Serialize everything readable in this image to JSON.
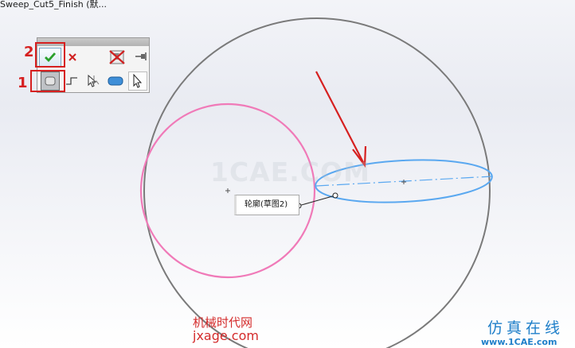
{
  "document": {
    "title": "Sweep_Cut5_Finish (默..."
  },
  "toolbar": {
    "ok_icon": "check-icon",
    "cancel_icon": "close-icon",
    "clear_selection_icon": "clear-selection-icon",
    "pin_icon": "pin-icon",
    "filters": [
      "profile-filter-icon",
      "curve-filter-icon",
      "select-other-icon",
      "face-filter-icon",
      "pointer-icon"
    ],
    "colors": {
      "ok": "#2aa02a",
      "cancel": "#d02020"
    }
  },
  "annotations": {
    "marker_1": "1",
    "marker_2": "2",
    "color": "#d62020"
  },
  "viewport": {
    "callout_label": "轮廓(草图2)",
    "colors": {
      "sphere": "#7a7a7a",
      "profile_circle": "#f07ab8",
      "path_ellipse": "#5aa8f0",
      "arrow": "#d62020"
    }
  },
  "watermarks": {
    "center": "1CAE.COM",
    "site_name": "机械时代网",
    "site_url": "jxage.com",
    "brand_cn": "仿真在线",
    "brand_url": "www.1CAE.com"
  }
}
